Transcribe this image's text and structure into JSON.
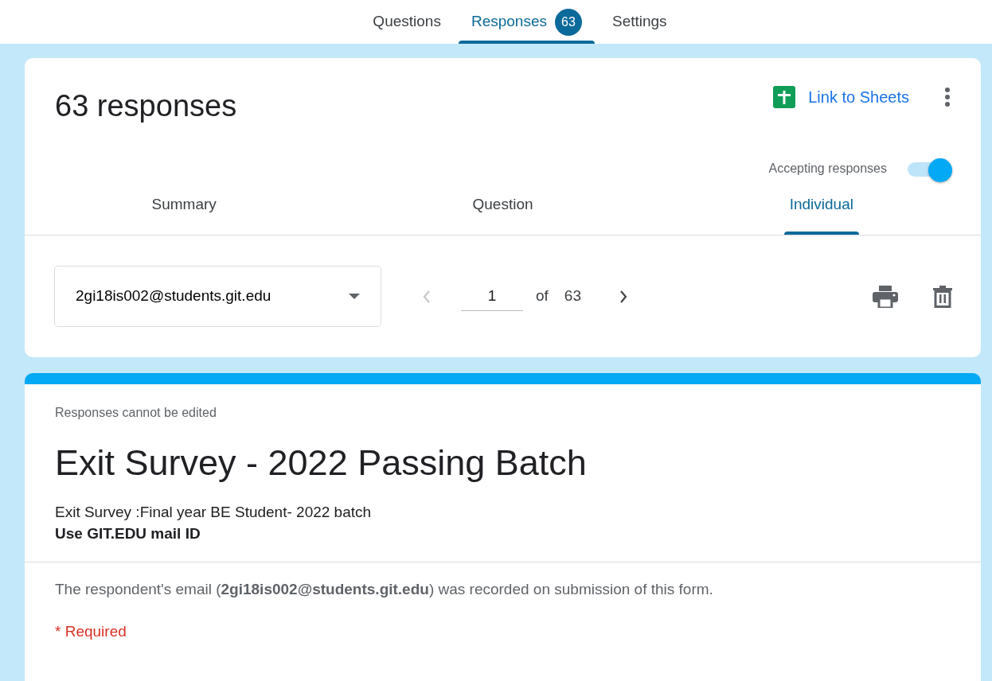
{
  "top_tabs": [
    {
      "label": "Questions",
      "selected": false
    },
    {
      "label": "Responses",
      "selected": true,
      "badge": "63"
    },
    {
      "label": "Settings",
      "selected": false
    }
  ],
  "responses_card": {
    "title": "63 responses",
    "link_to_sheets": "Link to Sheets",
    "accepting": {
      "label": "Accepting responses",
      "on": true
    },
    "view_tabs": [
      {
        "label": "Summary",
        "selected": false
      },
      {
        "label": "Question",
        "selected": false
      },
      {
        "label": "Individual",
        "selected": true
      }
    ],
    "respondent_select": {
      "value": "2gi18is002@students.git.edu"
    },
    "pager": {
      "prev_disabled": true,
      "current": "1",
      "of": "of",
      "total": "63",
      "next_disabled": false
    }
  },
  "form_card": {
    "notice": "Responses cannot be edited",
    "title": "Exit Survey - 2022 Passing Batch",
    "description": [
      {
        "text": "Exit Survey :Final year BE Student- 2022 batch",
        "bold": false
      },
      {
        "text": "Use GIT.EDU mail ID",
        "bold": true
      }
    ],
    "email_note": "The respondent's email (**2gi18is002@students.git.edu**) was recorded on submission of this form.",
    "required": "* Required"
  }
}
